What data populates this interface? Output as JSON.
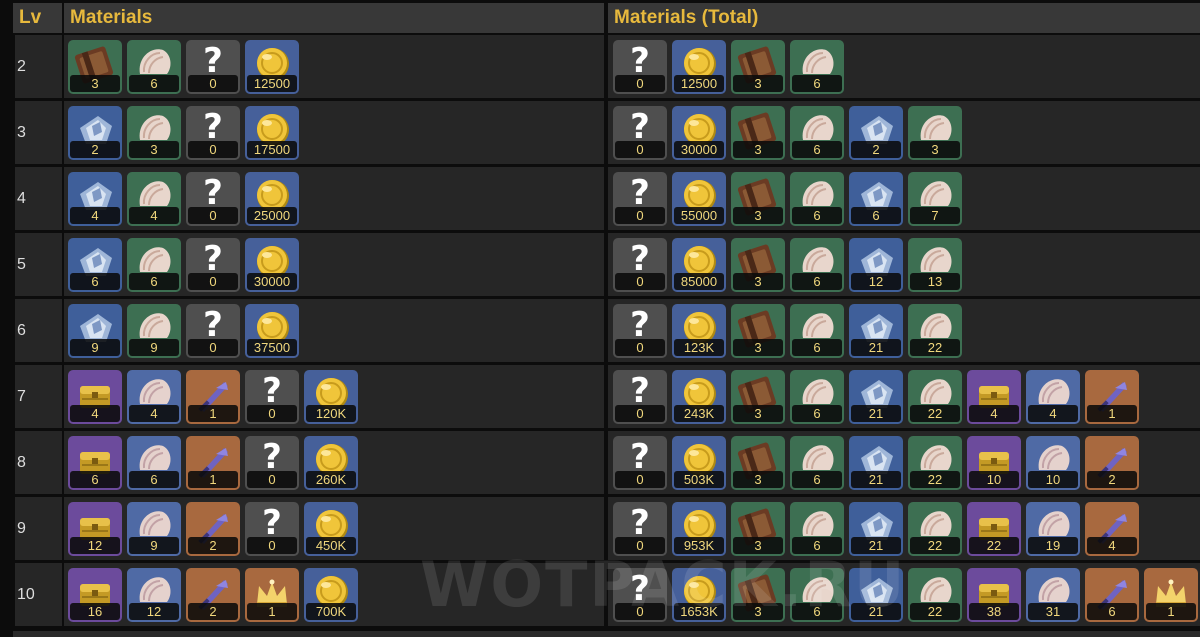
{
  "headers": {
    "lv": "Lv",
    "materials": "Materials",
    "total": "Materials (Total)"
  },
  "watermark": "WOTPACK.RU",
  "item_types": {
    "tome": {
      "icon": "leather-tome-icon",
      "bg": "#3d6f52"
    },
    "shell": {
      "icon": "seashell-icon",
      "bg": "#3d6f52"
    },
    "mystery": {
      "icon": "question-mark-icon",
      "bg": "#4f4f4f"
    },
    "gold": {
      "icon": "gold-coin-icon",
      "bg": "#46609a"
    },
    "crystal": {
      "icon": "blue-crystal-icon",
      "bg": "#3f5f9a"
    },
    "chest": {
      "icon": "golden-chest-icon",
      "bg": "#6c4b9c"
    },
    "shell_p": {
      "icon": "seashell-icon",
      "bg": "#4f6aa5"
    },
    "blade": {
      "icon": "purple-blade-icon",
      "bg": "#a8693f"
    },
    "crown": {
      "icon": "golden-crown-icon",
      "bg": "#a8693f"
    }
  },
  "rows": [
    {
      "lv": "2",
      "materials": [
        {
          "type": "tome",
          "value": "3"
        },
        {
          "type": "shell",
          "value": "6"
        },
        {
          "type": "mystery",
          "value": "0"
        },
        {
          "type": "gold",
          "value": "12500"
        }
      ],
      "total": [
        {
          "type": "mystery",
          "value": "0"
        },
        {
          "type": "gold",
          "value": "12500"
        },
        {
          "type": "tome",
          "value": "3"
        },
        {
          "type": "shell",
          "value": "6"
        }
      ]
    },
    {
      "lv": "3",
      "materials": [
        {
          "type": "crystal",
          "value": "2"
        },
        {
          "type": "shell",
          "value": "3"
        },
        {
          "type": "mystery",
          "value": "0"
        },
        {
          "type": "gold",
          "value": "17500"
        }
      ],
      "total": [
        {
          "type": "mystery",
          "value": "0"
        },
        {
          "type": "gold",
          "value": "30000"
        },
        {
          "type": "tome",
          "value": "3"
        },
        {
          "type": "shell",
          "value": "6"
        },
        {
          "type": "crystal",
          "value": "2"
        },
        {
          "type": "shell",
          "value": "3"
        }
      ]
    },
    {
      "lv": "4",
      "materials": [
        {
          "type": "crystal",
          "value": "4"
        },
        {
          "type": "shell",
          "value": "4"
        },
        {
          "type": "mystery",
          "value": "0"
        },
        {
          "type": "gold",
          "value": "25000"
        }
      ],
      "total": [
        {
          "type": "mystery",
          "value": "0"
        },
        {
          "type": "gold",
          "value": "55000"
        },
        {
          "type": "tome",
          "value": "3"
        },
        {
          "type": "shell",
          "value": "6"
        },
        {
          "type": "crystal",
          "value": "6"
        },
        {
          "type": "shell",
          "value": "7"
        }
      ]
    },
    {
      "lv": "5",
      "materials": [
        {
          "type": "crystal",
          "value": "6"
        },
        {
          "type": "shell",
          "value": "6"
        },
        {
          "type": "mystery",
          "value": "0"
        },
        {
          "type": "gold",
          "value": "30000"
        }
      ],
      "total": [
        {
          "type": "mystery",
          "value": "0"
        },
        {
          "type": "gold",
          "value": "85000"
        },
        {
          "type": "tome",
          "value": "3"
        },
        {
          "type": "shell",
          "value": "6"
        },
        {
          "type": "crystal",
          "value": "12"
        },
        {
          "type": "shell",
          "value": "13"
        }
      ]
    },
    {
      "lv": "6",
      "materials": [
        {
          "type": "crystal",
          "value": "9"
        },
        {
          "type": "shell",
          "value": "9"
        },
        {
          "type": "mystery",
          "value": "0"
        },
        {
          "type": "gold",
          "value": "37500"
        }
      ],
      "total": [
        {
          "type": "mystery",
          "value": "0"
        },
        {
          "type": "gold",
          "value": "123K"
        },
        {
          "type": "tome",
          "value": "3"
        },
        {
          "type": "shell",
          "value": "6"
        },
        {
          "type": "crystal",
          "value": "21"
        },
        {
          "type": "shell",
          "value": "22"
        }
      ]
    },
    {
      "lv": "7",
      "materials": [
        {
          "type": "chest",
          "value": "4"
        },
        {
          "type": "shell_p",
          "value": "4"
        },
        {
          "type": "blade",
          "value": "1"
        },
        {
          "type": "mystery",
          "value": "0"
        },
        {
          "type": "gold",
          "value": "120K"
        }
      ],
      "total": [
        {
          "type": "mystery",
          "value": "0"
        },
        {
          "type": "gold",
          "value": "243K"
        },
        {
          "type": "tome",
          "value": "3"
        },
        {
          "type": "shell",
          "value": "6"
        },
        {
          "type": "crystal",
          "value": "21"
        },
        {
          "type": "shell",
          "value": "22"
        },
        {
          "type": "chest",
          "value": "4"
        },
        {
          "type": "shell_p",
          "value": "4"
        },
        {
          "type": "blade",
          "value": "1"
        }
      ]
    },
    {
      "lv": "8",
      "materials": [
        {
          "type": "chest",
          "value": "6"
        },
        {
          "type": "shell_p",
          "value": "6"
        },
        {
          "type": "blade",
          "value": "1"
        },
        {
          "type": "mystery",
          "value": "0"
        },
        {
          "type": "gold",
          "value": "260K"
        }
      ],
      "total": [
        {
          "type": "mystery",
          "value": "0"
        },
        {
          "type": "gold",
          "value": "503K"
        },
        {
          "type": "tome",
          "value": "3"
        },
        {
          "type": "shell",
          "value": "6"
        },
        {
          "type": "crystal",
          "value": "21"
        },
        {
          "type": "shell",
          "value": "22"
        },
        {
          "type": "chest",
          "value": "10"
        },
        {
          "type": "shell_p",
          "value": "10"
        },
        {
          "type": "blade",
          "value": "2"
        }
      ]
    },
    {
      "lv": "9",
      "materials": [
        {
          "type": "chest",
          "value": "12"
        },
        {
          "type": "shell_p",
          "value": "9"
        },
        {
          "type": "blade",
          "value": "2"
        },
        {
          "type": "mystery",
          "value": "0"
        },
        {
          "type": "gold",
          "value": "450K"
        }
      ],
      "total": [
        {
          "type": "mystery",
          "value": "0"
        },
        {
          "type": "gold",
          "value": "953K"
        },
        {
          "type": "tome",
          "value": "3"
        },
        {
          "type": "shell",
          "value": "6"
        },
        {
          "type": "crystal",
          "value": "21"
        },
        {
          "type": "shell",
          "value": "22"
        },
        {
          "type": "chest",
          "value": "22"
        },
        {
          "type": "shell_p",
          "value": "19"
        },
        {
          "type": "blade",
          "value": "4"
        }
      ]
    },
    {
      "lv": "10",
      "materials": [
        {
          "type": "chest",
          "value": "16"
        },
        {
          "type": "shell_p",
          "value": "12"
        },
        {
          "type": "blade",
          "value": "2"
        },
        {
          "type": "crown",
          "value": "1"
        },
        {
          "type": "gold",
          "value": "700K"
        }
      ],
      "total": [
        {
          "type": "mystery",
          "value": "0"
        },
        {
          "type": "gold",
          "value": "1653K"
        },
        {
          "type": "tome",
          "value": "3"
        },
        {
          "type": "shell",
          "value": "6"
        },
        {
          "type": "crystal",
          "value": "21"
        },
        {
          "type": "shell",
          "value": "22"
        },
        {
          "type": "chest",
          "value": "38"
        },
        {
          "type": "shell_p",
          "value": "31"
        },
        {
          "type": "blade",
          "value": "6"
        },
        {
          "type": "crown",
          "value": "1"
        }
      ]
    }
  ]
}
